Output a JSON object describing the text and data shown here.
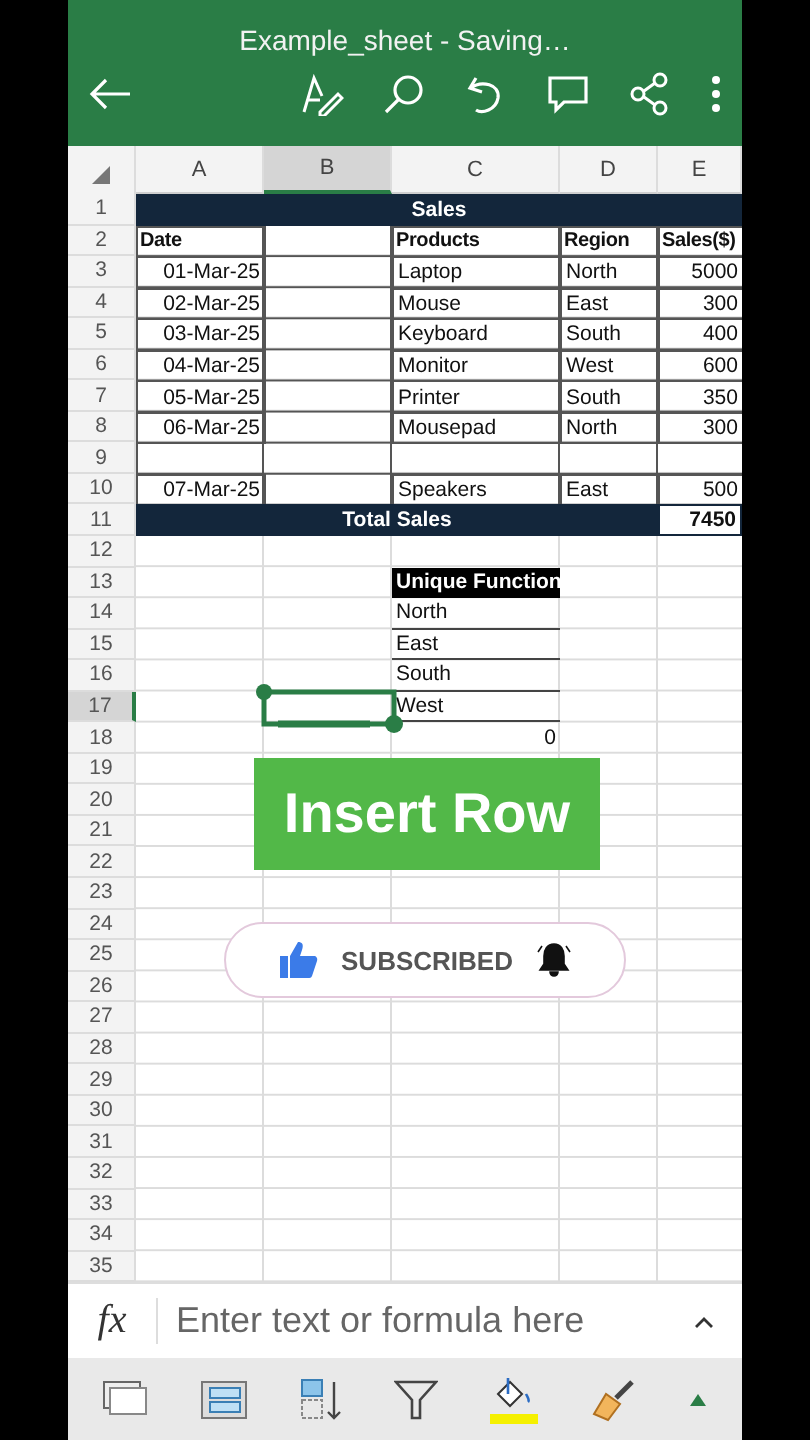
{
  "title": "Example_sheet - Saving…",
  "columns": [
    {
      "label": "A",
      "selected": false
    },
    {
      "label": "B",
      "selected": true
    },
    {
      "label": "C",
      "selected": false
    },
    {
      "label": "D",
      "selected": false
    },
    {
      "label": "E",
      "selected": false
    }
  ],
  "rows": [
    {
      "number": "1",
      "selected": false,
      "cells": [
        {
          "kind": "banner",
          "text": "Sales"
        }
      ]
    },
    {
      "number": "2",
      "selected": false,
      "cells": [
        {
          "kind": "header",
          "text": "Date"
        },
        {
          "kind": "blank"
        },
        {
          "kind": "header",
          "text": "Products"
        },
        {
          "kind": "header",
          "text": "Region"
        },
        {
          "kind": "header",
          "text": "Sales($)"
        }
      ]
    },
    {
      "number": "3",
      "selected": false,
      "cells": [
        {
          "kind": "date",
          "text": "01-Mar-25"
        },
        {
          "kind": "blank"
        },
        {
          "kind": "text",
          "text": "Laptop"
        },
        {
          "kind": "text",
          "text": "North"
        },
        {
          "kind": "number",
          "text": "5000"
        }
      ]
    },
    {
      "number": "4",
      "selected": false,
      "cells": [
        {
          "kind": "date",
          "text": "02-Mar-25"
        },
        {
          "kind": "blank"
        },
        {
          "kind": "text",
          "text": "Mouse"
        },
        {
          "kind": "text",
          "text": "East"
        },
        {
          "kind": "number",
          "text": "300"
        }
      ]
    },
    {
      "number": "5",
      "selected": false,
      "cells": [
        {
          "kind": "date",
          "text": "03-Mar-25"
        },
        {
          "kind": "blank"
        },
        {
          "kind": "text",
          "text": "Keyboard"
        },
        {
          "kind": "text",
          "text": "South"
        },
        {
          "kind": "number",
          "text": "400"
        }
      ]
    },
    {
      "number": "6",
      "selected": false,
      "cells": [
        {
          "kind": "date",
          "text": "04-Mar-25"
        },
        {
          "kind": "blank"
        },
        {
          "kind": "text",
          "text": "Monitor"
        },
        {
          "kind": "text",
          "text": "West"
        },
        {
          "kind": "number",
          "text": "600"
        }
      ]
    },
    {
      "number": "7",
      "selected": false,
      "cells": [
        {
          "kind": "date",
          "text": "05-Mar-25"
        },
        {
          "kind": "blank"
        },
        {
          "kind": "text",
          "text": "Printer"
        },
        {
          "kind": "text",
          "text": "South"
        },
        {
          "kind": "number",
          "text": "350"
        }
      ]
    },
    {
      "number": "8",
      "selected": false,
      "cells": [
        {
          "kind": "date",
          "text": "06-Mar-25"
        },
        {
          "kind": "blank"
        },
        {
          "kind": "text",
          "text": "Mousepad"
        },
        {
          "kind": "text",
          "text": "North"
        },
        {
          "kind": "number",
          "text": "300"
        }
      ]
    },
    {
      "number": "9",
      "selected": false,
      "cells": [
        {
          "kind": "blank"
        },
        {
          "kind": "blank"
        },
        {
          "kind": "blank"
        },
        {
          "kind": "blank"
        },
        {
          "kind": "blank"
        }
      ]
    },
    {
      "number": "10",
      "selected": false,
      "cells": [
        {
          "kind": "date",
          "text": "07-Mar-25"
        },
        {
          "kind": "blank"
        },
        {
          "kind": "text",
          "text": "Speakers"
        },
        {
          "kind": "text",
          "text": "East"
        },
        {
          "kind": "number",
          "text": "500"
        }
      ]
    },
    {
      "number": "11",
      "selected": false,
      "cells": [
        {
          "kind": "banner",
          "text": "Total Sales"
        },
        {
          "kind": "total",
          "text": "7450"
        }
      ]
    },
    {
      "number": "12",
      "selected": false
    },
    {
      "number": "13",
      "selected": false,
      "cells": [
        {
          "kind": "empty"
        },
        {
          "kind": "empty"
        },
        {
          "kind": "list-heading",
          "text": "Unique Function"
        }
      ]
    },
    {
      "number": "14",
      "selected": false,
      "cells": [
        {
          "kind": "empty"
        },
        {
          "kind": "empty"
        },
        {
          "kind": "list-item",
          "text": "North"
        }
      ]
    },
    {
      "number": "15",
      "selected": false,
      "cells": [
        {
          "kind": "empty"
        },
        {
          "kind": "empty"
        },
        {
          "kind": "list-item",
          "text": "East"
        }
      ]
    },
    {
      "number": "16",
      "selected": false,
      "cells": [
        {
          "kind": "empty"
        },
        {
          "kind": "empty"
        },
        {
          "kind": "list-item",
          "text": "South"
        }
      ]
    },
    {
      "number": "17",
      "selected": true,
      "cells": [
        {
          "kind": "empty"
        },
        {
          "kind": "cursor"
        },
        {
          "kind": "list-item",
          "text": "West"
        }
      ]
    },
    {
      "number": "18",
      "selected": false,
      "cells": [
        {
          "kind": "empty"
        },
        {
          "kind": "empty"
        },
        {
          "kind": "plain-number",
          "text": "0"
        }
      ]
    },
    {
      "number": "19",
      "selected": false
    },
    {
      "number": "20",
      "selected": false
    },
    {
      "number": "21",
      "selected": false
    },
    {
      "number": "22",
      "selected": false
    },
    {
      "number": "23",
      "selected": false
    },
    {
      "number": "24",
      "selected": false
    },
    {
      "number": "25",
      "selected": false
    },
    {
      "number": "26",
      "selected": false
    },
    {
      "number": "27",
      "selected": false
    },
    {
      "number": "28",
      "selected": false
    },
    {
      "number": "29",
      "selected": false
    },
    {
      "number": "30",
      "selected": false
    },
    {
      "number": "31",
      "selected": false
    },
    {
      "number": "32",
      "selected": false
    },
    {
      "number": "33",
      "selected": false
    },
    {
      "number": "34",
      "selected": false
    },
    {
      "number": "35",
      "selected": false
    }
  ],
  "overlay_banner": "Insert Row",
  "subscribe_button": {
    "label": "SUBSCRIBED"
  },
  "formula_bar": {
    "icon_text": "fx",
    "placeholder": "Enter text or formula here"
  }
}
